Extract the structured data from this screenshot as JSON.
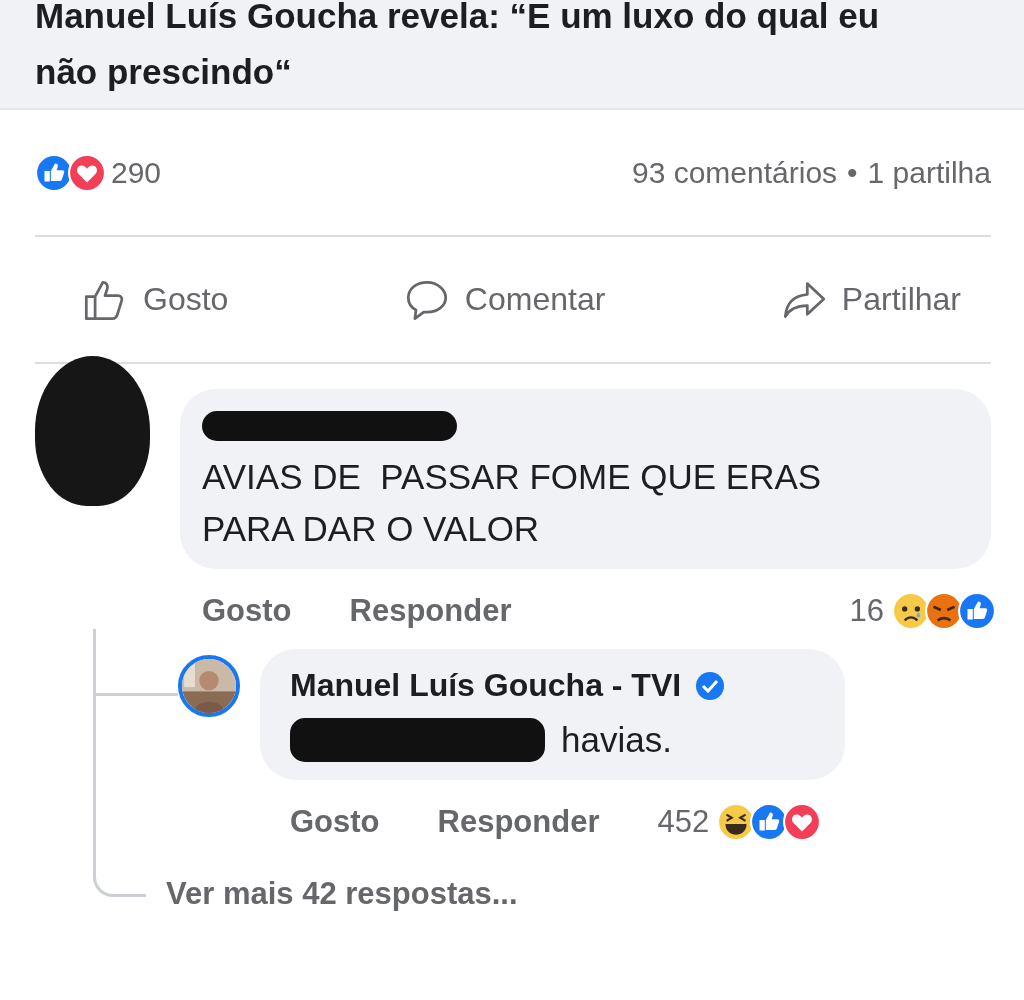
{
  "post": {
    "title": "Manuel Luís Goucha revela: “E um luxo do qual eu não prescindo“",
    "reactions": [
      {
        "kind": "like"
      },
      {
        "kind": "love"
      }
    ],
    "reaction_count": "290",
    "comments": "93 comentários",
    "separator": "•",
    "shares": "1 partilha",
    "actions": [
      {
        "label": "Gosto",
        "kind": "like"
      },
      {
        "label": "Comentar",
        "kind": "comment"
      },
      {
        "label": "Partilhar",
        "kind": "share"
      }
    ]
  },
  "comment": {
    "text": "AVIAS DE  PASSAR FOME QUE ERAS PARA DAR O VALOR",
    "actions": [
      "Gosto",
      "Responder"
    ],
    "reaction_count": "16",
    "reactions": [
      {
        "kind": "sad"
      },
      {
        "kind": "angry"
      },
      {
        "kind": "like"
      }
    ]
  },
  "reply": {
    "author": "Manuel Luís Goucha - TVI",
    "verified": true,
    "text": "havias.",
    "actions": [
      "Gosto",
      "Responder"
    ],
    "reaction_count": "452",
    "reactions": [
      {
        "kind": "haha"
      },
      {
        "kind": "like"
      },
      {
        "kind": "love"
      }
    ]
  },
  "more_replies": "Ver mais 42 respostas..."
}
